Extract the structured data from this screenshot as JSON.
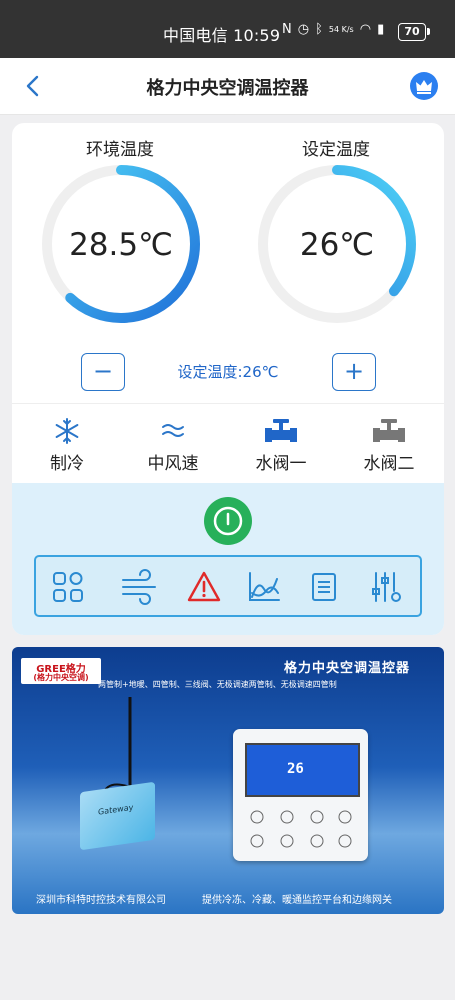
{
  "status_bar": {
    "carrier_time": "中国电信 10:59",
    "speed": "54 K/s",
    "battery": "70"
  },
  "nav": {
    "title": "格力中央空调温控器"
  },
  "gauges": {
    "ambient": {
      "label": "环境温度",
      "value": "28.5℃",
      "fill_fraction": 0.62
    },
    "setpoint": {
      "label": "设定温度",
      "value": "26℃",
      "fill_fraction": 0.36
    }
  },
  "setpoint_text": "设定温度:26℃",
  "controls": {
    "minus": "−",
    "plus": "+"
  },
  "modes": [
    {
      "label": "制冷",
      "icon": "snowflake-icon"
    },
    {
      "label": "中风速",
      "icon": "wind-icon"
    },
    {
      "label": "水阀一",
      "icon": "valve-blue-icon"
    },
    {
      "label": "水阀二",
      "icon": "valve-gray-icon"
    }
  ],
  "tools": [
    "grid-icon",
    "wind-flow-icon",
    "warning-icon",
    "chart-icon",
    "list-icon",
    "settings-sliders-icon"
  ],
  "colors": {
    "accent": "#2b76c9",
    "power": "#27b05a",
    "warning": "#e02a2a",
    "gauge_start": "#1f6fd8",
    "gauge_end": "#4fd3f7"
  },
  "banner": {
    "logo_text": "GREE格力",
    "logo_sub": "(格力中央空调)",
    "title": "格力中央空调温控器",
    "subtitle": "两管制+地暖、四管制、三线阀、无极调速两管制、无极调速四管制",
    "footer_left": "深圳市科特时控技术有限公司",
    "footer_right": "提供冷冻、冷藏、暖通监控平台和边缘网关",
    "panel_reading": "26",
    "gateway_label": "Gateway"
  }
}
